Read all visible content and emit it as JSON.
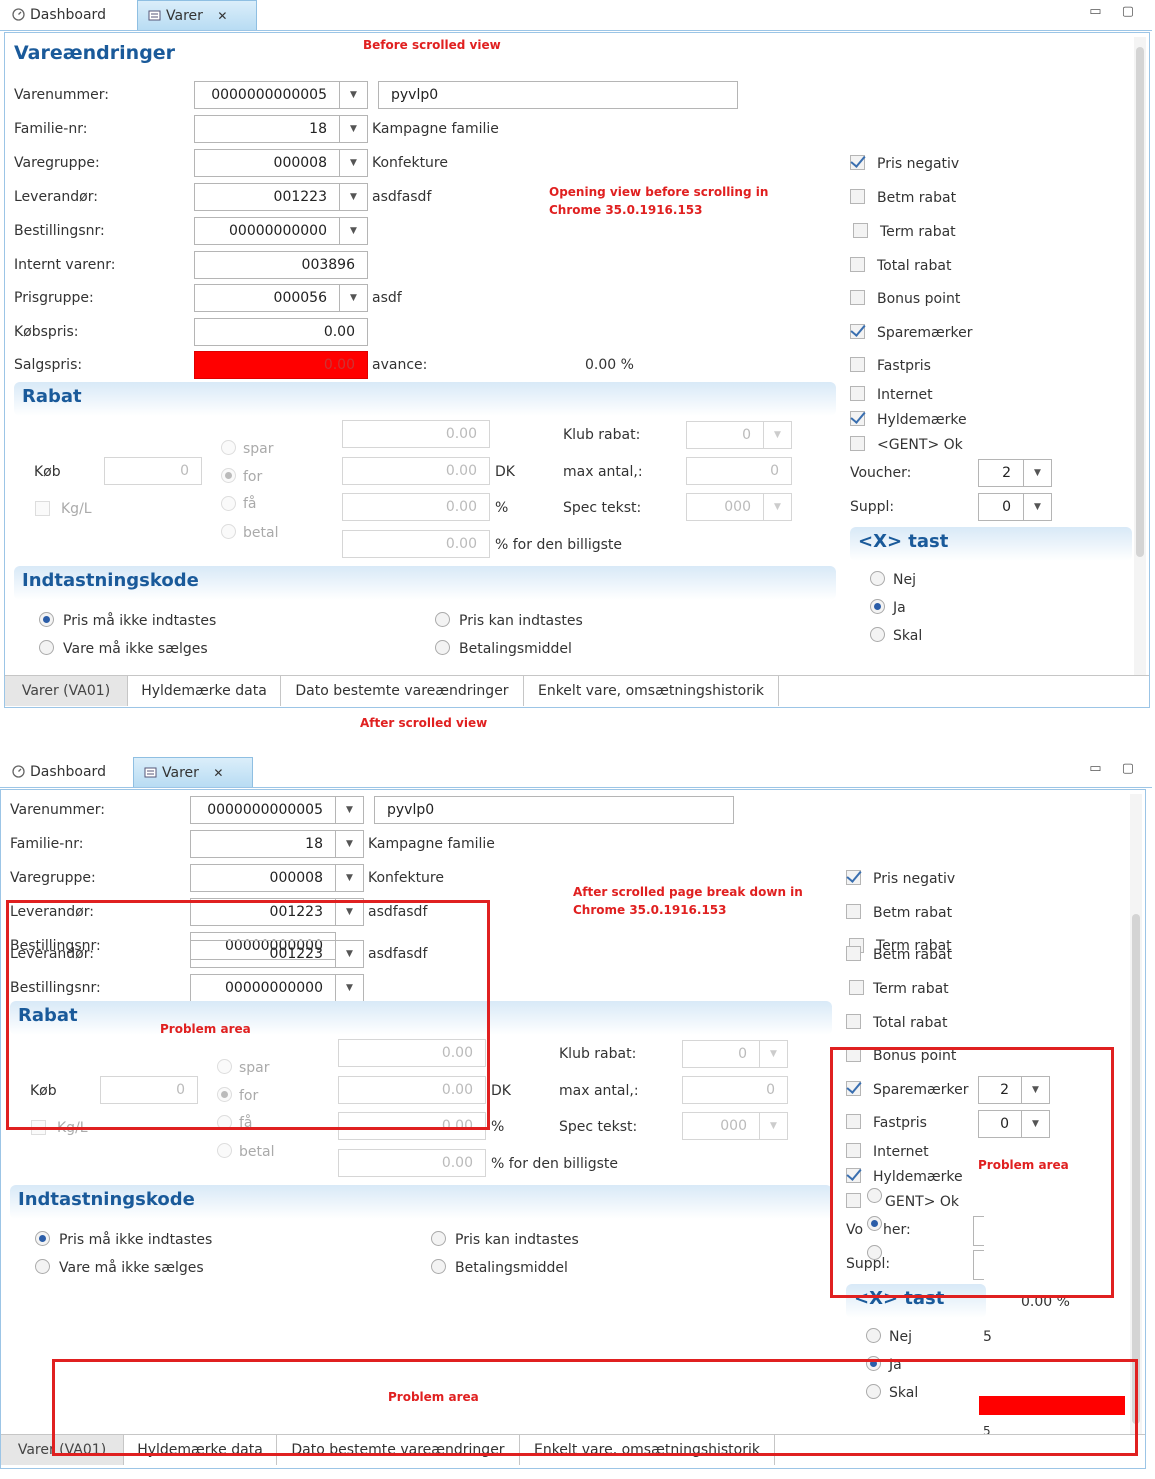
{
  "tabs": {
    "dashboard": "Dashboard",
    "varer": "Varer",
    "close": "✕"
  },
  "win_controls": "▭ ▢",
  "title": "Vareændringer",
  "notes": {
    "before": "Before scrolled view",
    "opening": "Opening view before scrolling in",
    "chrome": "Chrome 35.0.1916.153",
    "after": "After scrolled view",
    "after_break": "After scrolled page break down in",
    "problem": "Problem area"
  },
  "form": {
    "varenummer_label": "Varenummer:",
    "varenummer": "0000000000005",
    "varenavn": "pyvlp0",
    "familie_label": "Familie-nr:",
    "familie": "18",
    "familie_text": "Kampagne familie",
    "varegruppe_label": "Varegruppe:",
    "varegruppe": "000008",
    "varegruppe_text": "Konfekture",
    "leverandor_label": "Leverandør:",
    "leverandor": "001223",
    "leverandor_text": "asdfasdf",
    "bestilling_label": "Bestillingsnr:",
    "bestilling": "00000000000",
    "internt_label": "Internt varenr:",
    "internt": "003896",
    "prisgruppe_label": "Prisgruppe:",
    "prisgruppe": "000056",
    "prisgruppe_text": "asdf",
    "kobspris_label": "Købspris:",
    "kobspris": "0.00",
    "salgspris_label": "Salgspris:",
    "salgspris": "0.00",
    "avance_label": "avance:",
    "avance": "0.00 %"
  },
  "checks": {
    "pris_negativ": "Pris negativ",
    "betm_rabat": "Betm rabat",
    "term_rabat": "Term rabat",
    "total_rabat": "Total rabat",
    "bonus_point": "Bonus point",
    "sparemaerker": "Sparemærker",
    "fastpris": "Fastpris",
    "internet": "Internet",
    "hyldemaerke": "Hyldemærke",
    "gent_ok": "<GENT> Ok",
    "voucher_label": "Voucher:",
    "voucher": "2",
    "suppl_label": "Suppl:",
    "suppl": "0"
  },
  "rabat": {
    "title": "Rabat",
    "kob": "Køb",
    "kob_val": "0",
    "kgl": "Kg/L",
    "spar": "spar",
    "for": "for",
    "fa": "få",
    "betal": "betal",
    "v1": "0.00",
    "v2": "0.00",
    "v3": "0.00",
    "v4": "0.00",
    "dk": "DK",
    "pct": "%",
    "billigste": "% for den billigste",
    "klub_label": "Klub rabat:",
    "klub": "0",
    "max_label": "max antal,:",
    "max": "0",
    "spec_label": "Spec tekst:",
    "spec": "000"
  },
  "xtast": {
    "title": "<X> tast",
    "nej": "Nej",
    "ja": "Ja",
    "skal": "Skal"
  },
  "indtast": {
    "title": "Indtastningskode",
    "opt1": "Pris må ikke indtastes",
    "opt2": "Vare må ikke sælges",
    "opt3": "Pris kan indtastes",
    "opt4": "Betalingsmiddel"
  },
  "bottom_tabs": [
    "Varer (VA01)",
    "Hyldemærke data",
    "Dato bestemte vareændringer",
    "Enkelt vare, omsætningshistorik"
  ],
  "after_extra": {
    "pct": "0.00  %",
    "five": "5",
    "five2": "5",
    "dup_lev": "001223",
    "dup_best": "00000000000",
    "dup_text": "asdfasdf",
    "dup_term": "Term rabat",
    "dup_betm": "Betm rabat",
    "trunc_gent": "GENT> Ok",
    "trunc_vo": "Vo",
    "trunc_her": "her:",
    "kgl_broken": "Kg/L"
  }
}
